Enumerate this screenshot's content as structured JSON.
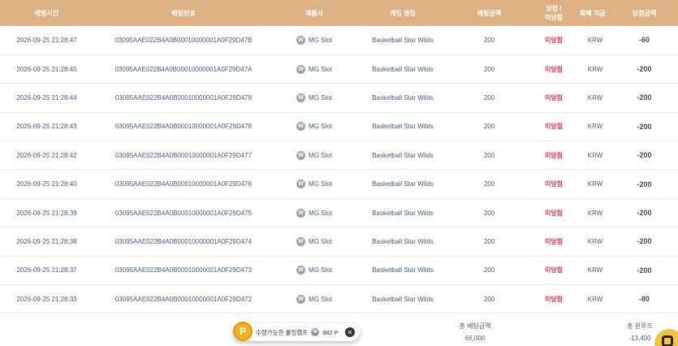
{
  "headers": {
    "bet_time": "베팅시간",
    "bet_number": "베팅번호",
    "provider": "제품사",
    "game_name": "게임 명칭",
    "bet_amount": "베팅금액",
    "result_line1": "당첨 /",
    "result_line2": "미당첨",
    "currency": "화폐 지급",
    "win_amount": "당첨금액"
  },
  "rows": [
    {
      "time": "2026-09-25 21:28:47",
      "id": "03095AAE022B4A0B00010000001A0F29D47B",
      "provider": "MG Slot",
      "game": "Basketball Star Wilds",
      "bet": "200",
      "result": "미당첨",
      "currency": "KRW",
      "win": "-60"
    },
    {
      "time": "2026-09-25 21:28:45",
      "id": "03095AAE022B4A0B00010000001A0F29D47A",
      "provider": "MG Slot",
      "game": "Basketball Star Wilds",
      "bet": "200",
      "result": "미당첨",
      "currency": "KRW",
      "win": "-200"
    },
    {
      "time": "2026-09-25 21:28:44",
      "id": "03095AAE022B4A0B00010000001A0F29D479",
      "provider": "MG Slot",
      "game": "Basketball Star Wilds",
      "bet": "200",
      "result": "미당첨",
      "currency": "KRW",
      "win": "-200"
    },
    {
      "time": "2026-09-25 21:28:43",
      "id": "03095AAE022B4A0B00010000001A0F29D478",
      "provider": "MG Slot",
      "game": "Basketball Star Wilds",
      "bet": "200",
      "result": "미당첨",
      "currency": "KRW",
      "win": "-200"
    },
    {
      "time": "2026-09-25 21:28:42",
      "id": "03095AAE022B4A0B00010000001A0F29D477",
      "provider": "MG Slot",
      "game": "Basketball Star Wilds",
      "bet": "200",
      "result": "미당첨",
      "currency": "KRW",
      "win": "-200"
    },
    {
      "time": "2026-09-25 21:28:40",
      "id": "03095AAE022B4A0B00010000001A0F29D476",
      "provider": "MG Slot",
      "game": "Basketball Star Wilds",
      "bet": "200",
      "result": "미당첨",
      "currency": "KRW",
      "win": "-200"
    },
    {
      "time": "2026-09-25 21:28:39",
      "id": "03095AAE022B4A0B00010000001A0F29D475",
      "provider": "MG Slot",
      "game": "Basketball Star Wilds",
      "bet": "200",
      "result": "미당첨",
      "currency": "KRW",
      "win": "-200"
    },
    {
      "time": "2026-09-25 21:28:38",
      "id": "03095AAE022B4A0B00010000001A0F29D474",
      "provider": "MG Slot",
      "game": "Basketball Star Wilds",
      "bet": "200",
      "result": "미당첨",
      "currency": "KRW",
      "win": "-200"
    },
    {
      "time": "2026-09-25 21:28:37",
      "id": "03095AAE022B4A0B00010000001A0F29D473",
      "provider": "MG Slot",
      "game": "Basketball Star Wilds",
      "bet": "200",
      "result": "미당첨",
      "currency": "KRW",
      "win": "-200"
    },
    {
      "time": "2026-09-25 21:28:33",
      "id": "03095AAE022B4A0B00010000001A0F29D472",
      "provider": "MG Slot",
      "game": "Basketball Star Wilds",
      "bet": "200",
      "result": "미당첨",
      "currency": "KRW",
      "win": "-80"
    }
  ],
  "summary": {
    "total_bet_label": "총 베팅금액",
    "total_bet_value": "66,000",
    "total_win_label": "총 윈루즈",
    "total_win_value": "-13,400"
  },
  "toast": {
    "p_icon": "P",
    "label": "수령가능한 롤링캠프",
    "w_icon": "W",
    "points": "982 P",
    "close_icon": "✕"
  },
  "provider_icon": "W",
  "icons": {
    "provider": "w-badge-icon",
    "points": "p-coin-icon",
    "close": "close-icon",
    "chat": "chat-icon"
  },
  "colors": {
    "header_bg": "#deb184",
    "lose_text": "#e8324c",
    "points_coin": "#f0b020",
    "chat_button": "#f3c53a"
  }
}
